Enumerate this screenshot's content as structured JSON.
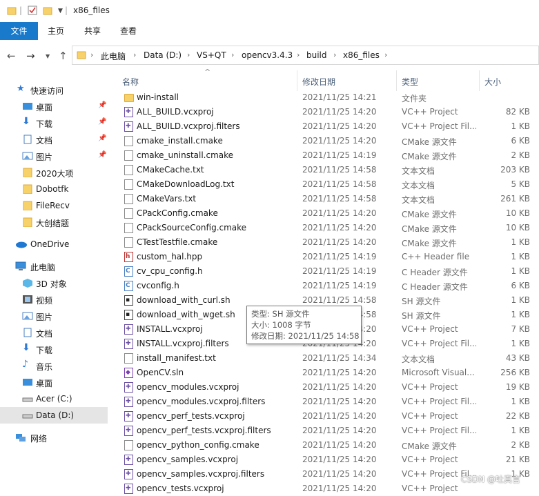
{
  "window": {
    "title": "x86_files"
  },
  "ribbon": {
    "tabs": [
      "文件",
      "主页",
      "共享",
      "查看"
    ]
  },
  "address": {
    "crumbs": [
      "此电脑",
      "Data (D:)",
      "VS+QT",
      "opencv3.4.3",
      "build",
      "x86_files"
    ]
  },
  "nav": {
    "items": [
      {
        "label": "快速访问",
        "icon": "star-icon",
        "pinned": false
      },
      {
        "label": "桌面",
        "icon": "desktop-icon",
        "pinned": true
      },
      {
        "label": "下载",
        "icon": "download-icon",
        "pinned": true
      },
      {
        "label": "文档",
        "icon": "documents-icon",
        "pinned": true
      },
      {
        "label": "图片",
        "icon": "pictures-icon",
        "pinned": true
      },
      {
        "label": "2020大项",
        "icon": "folder-icon",
        "pinned": false
      },
      {
        "label": "Dobotfk",
        "icon": "folder-icon",
        "pinned": false
      },
      {
        "label": "FileRecv",
        "icon": "folder-icon",
        "pinned": false
      },
      {
        "label": "大创结题",
        "icon": "folder-icon",
        "pinned": false
      },
      {
        "label": "OneDrive",
        "icon": "cloud-icon",
        "pinned": false
      },
      {
        "label": "此电脑",
        "icon": "pc-icon",
        "pinned": false
      },
      {
        "label": "3D 对象",
        "icon": "3d-objects-icon",
        "pinned": false
      },
      {
        "label": "视频",
        "icon": "videos-icon",
        "pinned": false
      },
      {
        "label": "图片",
        "icon": "pictures-icon",
        "pinned": false
      },
      {
        "label": "文档",
        "icon": "documents-icon",
        "pinned": false
      },
      {
        "label": "下载",
        "icon": "download-icon",
        "pinned": false
      },
      {
        "label": "音乐",
        "icon": "music-icon",
        "pinned": false
      },
      {
        "label": "桌面",
        "icon": "desktop-icon",
        "pinned": false
      },
      {
        "label": "Acer (C:)",
        "icon": "drive-icon",
        "pinned": false
      },
      {
        "label": "Data (D:)",
        "icon": "drive-icon",
        "pinned": false,
        "selected": true
      },
      {
        "label": "网络",
        "icon": "network-icon",
        "pinned": false
      }
    ]
  },
  "columns": {
    "name": "名称",
    "date": "修改日期",
    "type": "类型",
    "size": "大小"
  },
  "files": [
    {
      "name": "win-install",
      "date": "2021/11/25 14:21",
      "type": "文件夹",
      "size": "",
      "icon": "folder"
    },
    {
      "name": "ALL_BUILD.vcxproj",
      "date": "2021/11/25 14:20",
      "type": "VC++ Project",
      "size": "82 KB",
      "icon": "vc"
    },
    {
      "name": "ALL_BUILD.vcxproj.filters",
      "date": "2021/11/25 14:20",
      "type": "VC++ Project Fil...",
      "size": "1 KB",
      "icon": "vc"
    },
    {
      "name": "cmake_install.cmake",
      "date": "2021/11/25 14:20",
      "type": "CMake 源文件",
      "size": "6 KB",
      "icon": "doc"
    },
    {
      "name": "cmake_uninstall.cmake",
      "date": "2021/11/25 14:19",
      "type": "CMake 源文件",
      "size": "2 KB",
      "icon": "doc"
    },
    {
      "name": "CMakeCache.txt",
      "date": "2021/11/25 14:58",
      "type": "文本文档",
      "size": "203 KB",
      "icon": "doc"
    },
    {
      "name": "CMakeDownloadLog.txt",
      "date": "2021/11/25 14:58",
      "type": "文本文档",
      "size": "5 KB",
      "icon": "doc"
    },
    {
      "name": "CMakeVars.txt",
      "date": "2021/11/25 14:58",
      "type": "文本文档",
      "size": "261 KB",
      "icon": "doc"
    },
    {
      "name": "CPackConfig.cmake",
      "date": "2021/11/25 14:20",
      "type": "CMake 源文件",
      "size": "10 KB",
      "icon": "doc"
    },
    {
      "name": "CPackSourceConfig.cmake",
      "date": "2021/11/25 14:20",
      "type": "CMake 源文件",
      "size": "10 KB",
      "icon": "doc"
    },
    {
      "name": "CTestTestfile.cmake",
      "date": "2021/11/25 14:20",
      "type": "CMake 源文件",
      "size": "1 KB",
      "icon": "doc"
    },
    {
      "name": "custom_hal.hpp",
      "date": "2021/11/25 14:19",
      "type": "C++ Header file",
      "size": "1 KB",
      "icon": "h"
    },
    {
      "name": "cv_cpu_config.h",
      "date": "2021/11/25 14:19",
      "type": "C Header 源文件",
      "size": "1 KB",
      "icon": "c"
    },
    {
      "name": "cvconfig.h",
      "date": "2021/11/25 14:19",
      "type": "C Header 源文件",
      "size": "6 KB",
      "icon": "c"
    },
    {
      "name": "download_with_curl.sh",
      "date": "2021/11/25 14:58",
      "type": "SH 源文件",
      "size": "1 KB",
      "icon": "sh"
    },
    {
      "name": "download_with_wget.sh",
      "date": "2021/11/25 14:58",
      "type": "SH 源文件",
      "size": "1 KB",
      "icon": "sh"
    },
    {
      "name": "INSTALL.vcxproj",
      "date": "2021/11/25 14:20",
      "type": "VC++ Project",
      "size": "7 KB",
      "icon": "vc"
    },
    {
      "name": "INSTALL.vcxproj.filters",
      "date": "2021/11/25 14:20",
      "type": "VC++ Project Fil...",
      "size": "1 KB",
      "icon": "vc"
    },
    {
      "name": "install_manifest.txt",
      "date": "2021/11/25 14:34",
      "type": "文本文档",
      "size": "43 KB",
      "icon": "doc"
    },
    {
      "name": "OpenCV.sln",
      "date": "2021/11/25 14:20",
      "type": "Microsoft Visual...",
      "size": "256 KB",
      "icon": "sln"
    },
    {
      "name": "opencv_modules.vcxproj",
      "date": "2021/11/25 14:20",
      "type": "VC++ Project",
      "size": "19 KB",
      "icon": "vc"
    },
    {
      "name": "opencv_modules.vcxproj.filters",
      "date": "2021/11/25 14:20",
      "type": "VC++ Project Fil...",
      "size": "1 KB",
      "icon": "vc"
    },
    {
      "name": "opencv_perf_tests.vcxproj",
      "date": "2021/11/25 14:20",
      "type": "VC++ Project",
      "size": "22 KB",
      "icon": "vc"
    },
    {
      "name": "opencv_perf_tests.vcxproj.filters",
      "date": "2021/11/25 14:20",
      "type": "VC++ Project Fil...",
      "size": "1 KB",
      "icon": "vc"
    },
    {
      "name": "opencv_python_config.cmake",
      "date": "2021/11/25 14:20",
      "type": "CMake 源文件",
      "size": "2 KB",
      "icon": "doc"
    },
    {
      "name": "opencv_samples.vcxproj",
      "date": "2021/11/25 14:20",
      "type": "VC++ Project",
      "size": "21 KB",
      "icon": "vc"
    },
    {
      "name": "opencv_samples.vcxproj.filters",
      "date": "2021/11/25 14:20",
      "type": "VC++ Project Fil...",
      "size": "1 KB",
      "icon": "vc"
    },
    {
      "name": "opencv_tests.vcxproj",
      "date": "2021/11/25 14:20",
      "type": "VC++ Project",
      "size": "",
      "icon": "vc"
    }
  ],
  "tooltip": {
    "type": "类型: SH 源文件",
    "size": "大小: 1008 字节",
    "modified": "修改日期: 2021/11/25 14:58"
  },
  "watermark": "CSDN @吐真言",
  "colors": {
    "accent": "#1979ca",
    "selected": "#e5e5e5",
    "folder": "#f7d26a"
  }
}
